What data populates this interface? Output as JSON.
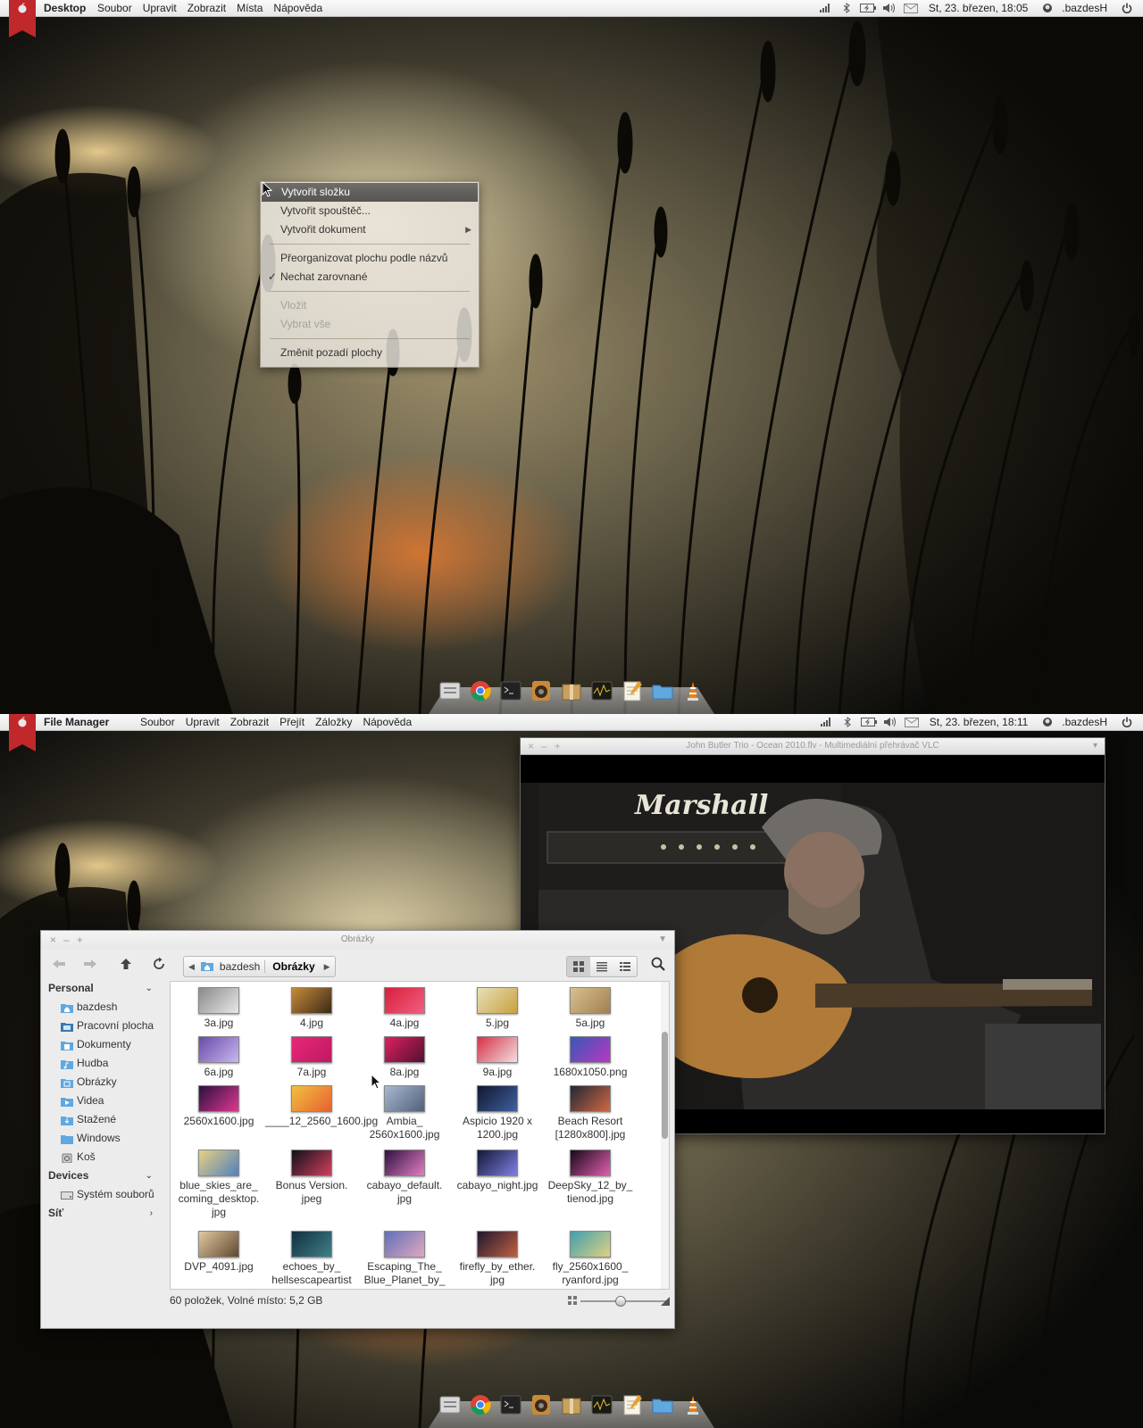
{
  "top": {
    "menubar": {
      "app_name": "Desktop",
      "items": [
        "Soubor",
        "Upravit",
        "Zobrazit",
        "Místa",
        "Nápověda"
      ],
      "clock": "St, 23. březen, 18:05",
      "user": ".bazdesH"
    },
    "context_menu": {
      "items": [
        {
          "label": "Vytvořit složku",
          "state": "highlighted"
        },
        {
          "label": "Vytvořit spouštěč...",
          "state": "normal"
        },
        {
          "label": "Vytvořit dokument",
          "state": "submenu"
        },
        {
          "label": "Přeorganizovat plochu podle názvů",
          "state": "normal"
        },
        {
          "label": "Nechat zarovnané",
          "state": "checked"
        },
        {
          "label": "Vložit",
          "state": "disabled"
        },
        {
          "label": "Vybrat vše",
          "state": "disabled"
        },
        {
          "label": "Změnit pozadí plochy",
          "state": "normal"
        }
      ]
    }
  },
  "bottom": {
    "menubar": {
      "app_name": "File Manager",
      "items": [
        "Soubor",
        "Upravit",
        "Zobrazit",
        "Přejít",
        "Záložky",
        "Nápověda"
      ],
      "clock": "St, 23. březen, 18:11",
      "user": ".bazdesH"
    },
    "vlc": {
      "title": "John Butler Trio - Ocean 2010.flv - Multimediální přehrávač VLC",
      "amp_brand": "Marshall"
    },
    "file_manager": {
      "title": "Obrázky",
      "breadcrumb": [
        "bazdesh",
        "Obrázky"
      ],
      "sidebar": {
        "personal_header": "Personal",
        "personal_items": [
          "bazdesh",
          "Pracovní plocha",
          "Dokumenty",
          "Hudba",
          "Obrázky",
          "Videa",
          "Stažené",
          "Windows",
          "Koš"
        ],
        "devices_header": "Devices",
        "devices_items": [
          "Systém souborů"
        ],
        "network_header": "Síť"
      },
      "files": [
        {
          "name": "3a.jpg",
          "colors": [
            "#8a8a8a",
            "#e8e8e8"
          ]
        },
        {
          "name": "4.jpg",
          "colors": [
            "#c88a3a",
            "#3a2a18"
          ]
        },
        {
          "name": "4a.jpg",
          "colors": [
            "#d81e3a",
            "#f06080"
          ]
        },
        {
          "name": "5.jpg",
          "colors": [
            "#e8e0b8",
            "#c8a040"
          ]
        },
        {
          "name": "5a.jpg",
          "colors": [
            "#d8c090",
            "#a08050"
          ]
        },
        {
          "name": "6a.jpg",
          "colors": [
            "#6a4aa8",
            "#c8b8f0"
          ]
        },
        {
          "name": "7a.jpg",
          "colors": [
            "#e8287a",
            "#c01860"
          ]
        },
        {
          "name": "8a.jpg",
          "colors": [
            "#e02060",
            "#501030"
          ]
        },
        {
          "name": "9a.jpg",
          "colors": [
            "#d83048",
            "#f0e0e0"
          ]
        },
        {
          "name": "1680x1050.png",
          "colors": [
            "#3858b8",
            "#b838c0"
          ]
        },
        {
          "name": "2560x1600.jpg",
          "colors": [
            "#2a1040",
            "#e03890"
          ]
        },
        {
          "name": "____12_2560_1600.jpg",
          "colors": [
            "#f0c040",
            "#e86030"
          ]
        },
        {
          "name": "Ambia_ 2560x1600.jpg",
          "colors": [
            "#a8b8d0",
            "#506078"
          ]
        },
        {
          "name": "Aspicio 1920 x 1200.jpg",
          "colors": [
            "#101830",
            "#4060a0"
          ]
        },
        {
          "name": "Beach Resort [1280x800].jpg",
          "colors": [
            "#202838",
            "#d06840"
          ]
        },
        {
          "name": "blue_skies_are_ coming_desktop. jpg",
          "colors": [
            "#e8d080",
            "#5080c0"
          ]
        },
        {
          "name": "Bonus Version. jpeg",
          "colors": [
            "#101018",
            "#d04060"
          ]
        },
        {
          "name": "cabayo_default. jpg",
          "colors": [
            "#301040",
            "#e080c0"
          ]
        },
        {
          "name": "cabayo_night.jpg",
          "colors": [
            "#101838",
            "#8080e0"
          ]
        },
        {
          "name": "DeepSky_12_by_ tienod.jpg",
          "colors": [
            "#180818",
            "#e060b0"
          ]
        },
        {
          "name": "DVP_4091.jpg",
          "colors": [
            "#e0c8a0",
            "#604830"
          ]
        },
        {
          "name": "echoes_by_ hellsescapeartist",
          "colors": [
            "#103040",
            "#408088"
          ]
        },
        {
          "name": "Escaping_The_ Blue_Planet_by_",
          "colors": [
            "#6070b8",
            "#e0a8c0"
          ]
        },
        {
          "name": "firefly_by_ether. jpg",
          "colors": [
            "#201830",
            "#c06040"
          ]
        },
        {
          "name": "fly_2560x1600_ ryanford.jpg",
          "colors": [
            "#40a0b0",
            "#e0d080"
          ]
        }
      ],
      "status": "60 položek, Volné místo: 5,2 GB",
      "zoom_fraction": 0.45
    }
  }
}
